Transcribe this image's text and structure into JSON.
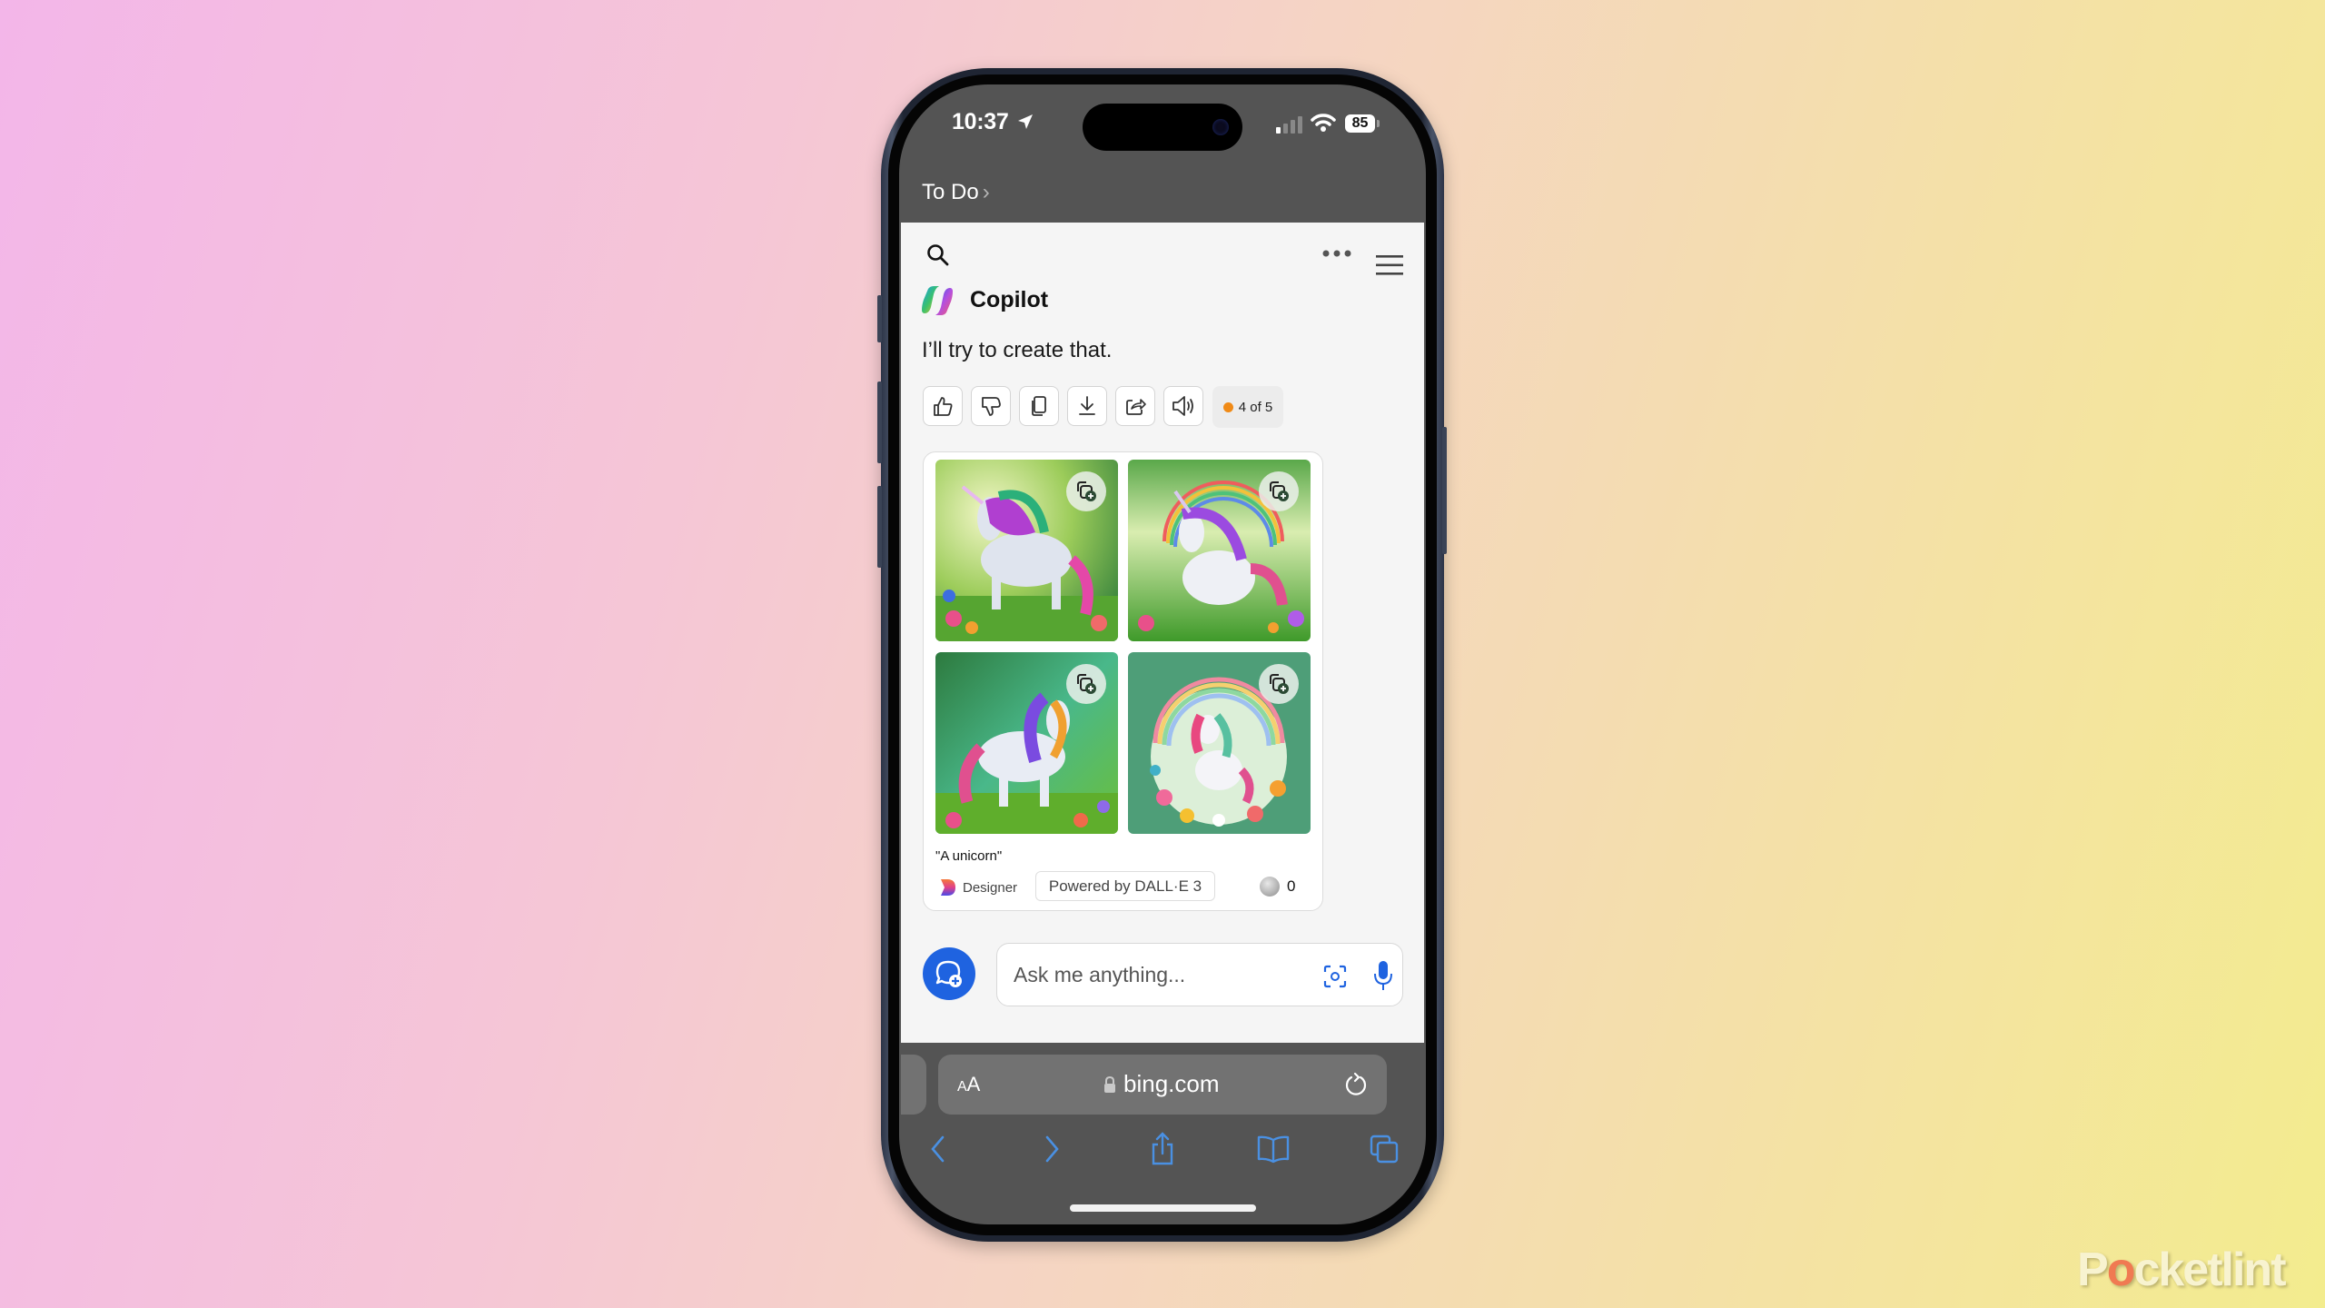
{
  "status_bar": {
    "time": "10:37",
    "location_icon": "location-arrow-icon",
    "signal_icon": "cellular-signal-icon",
    "wifi_icon": "wifi-icon",
    "battery_level": "85"
  },
  "back_navigation": {
    "label": "To Do",
    "chevron": "›"
  },
  "copilot": {
    "header_icons": [
      "search-icon",
      "more-dots-icon",
      "hamburger-menu-icon"
    ],
    "title": "Copilot",
    "message": "I’ll try to create that.",
    "actions": [
      {
        "name": "thumbs-up",
        "icon": "thumbs-up-icon"
      },
      {
        "name": "thumbs-down",
        "icon": "thumbs-down-icon"
      },
      {
        "name": "copy",
        "icon": "copy-icon"
      },
      {
        "name": "download",
        "icon": "download-icon"
      },
      {
        "name": "share",
        "icon": "share-icon"
      },
      {
        "name": "read-aloud",
        "icon": "speaker-icon"
      }
    ],
    "response_counter": "4 of 5",
    "response_counter_color": "#f08a16",
    "image_card": {
      "images": [
        {
          "alt": "Unicorn with rainbow mane in flower meadow",
          "scene": "meadow"
        },
        {
          "alt": "Unicorn under rainbow in forest",
          "scene": "rainbow-forest"
        },
        {
          "alt": "Unicorn in sunlit forest clearing",
          "scene": "forest-clearing"
        },
        {
          "alt": "Cartoon unicorn with rainbow and flower wreath",
          "scene": "wreath"
        }
      ],
      "image_action_icon": "add-to-collection-icon",
      "caption": "\"A unicorn\"",
      "designer_label": "Designer",
      "powered_by": "Powered by DALL·E 3",
      "boost_count": "0"
    },
    "input": {
      "placeholder": "Ask me anything...",
      "value": "",
      "new_topic_icon": "new-chat-icon",
      "visual_search_icon": "camera-scan-icon",
      "mic_icon": "microphone-icon"
    },
    "accent_color": "#1f63e0"
  },
  "safari": {
    "text_size_label_small": "A",
    "text_size_label_large": "A",
    "url": "bing.com",
    "lock_icon": "lock-icon",
    "reload_icon": "reload-icon",
    "toolbar": [
      "back-icon",
      "forward-icon",
      "share-icon",
      "bookmarks-icon",
      "tabs-icon"
    ],
    "icon_color": "#4a90e2"
  },
  "watermark": {
    "pre": "P",
    "o": "o",
    "post": "cketlint"
  }
}
